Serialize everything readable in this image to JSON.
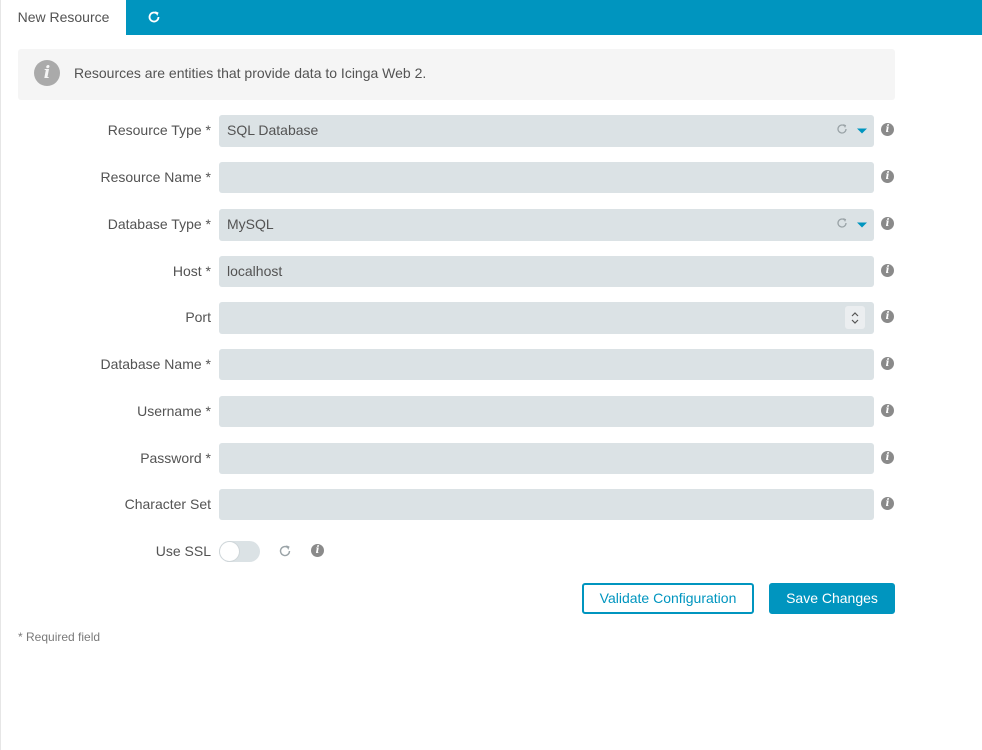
{
  "tabs": {
    "active_label": "New Resource",
    "refresh_icon": "refresh-icon"
  },
  "info": {
    "icon": "info-icon",
    "text": "Resources are entities that provide data to Icinga Web 2."
  },
  "form": {
    "resource_type": {
      "label": "Resource Type *",
      "value": "SQL Database"
    },
    "resource_name": {
      "label": "Resource Name *",
      "value": ""
    },
    "database_type": {
      "label": "Database Type *",
      "value": "MySQL"
    },
    "host": {
      "label": "Host *",
      "value": "localhost"
    },
    "port": {
      "label": "Port",
      "value": ""
    },
    "database_name": {
      "label": "Database Name *",
      "value": ""
    },
    "username": {
      "label": "Username *",
      "value": ""
    },
    "password": {
      "label": "Password *",
      "value": ""
    },
    "character_set": {
      "label": "Character Set",
      "value": ""
    },
    "use_ssl": {
      "label": "Use SSL",
      "checked": false
    }
  },
  "buttons": {
    "validate": "Validate Configuration",
    "save": "Save Changes"
  },
  "required_note": "* Required field",
  "colors": {
    "accent": "#0095bf",
    "field_bg": "#dbe2e5",
    "info_bg": "#f5f5f5",
    "text": "#535353"
  }
}
